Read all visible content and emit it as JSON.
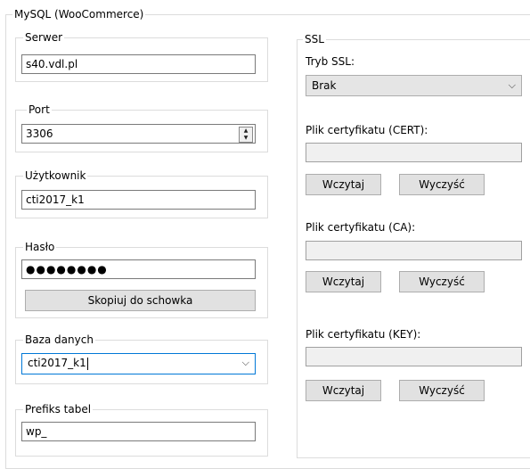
{
  "mysql_group": {
    "title": "MySQL (WooCommerce)"
  },
  "server": {
    "label": "Serwer",
    "value": "s40.vdl.pl"
  },
  "port": {
    "label": "Port",
    "value": "3306"
  },
  "user": {
    "label": "Użytkownik",
    "value": "cti2017_k1"
  },
  "password": {
    "label": "Hasło",
    "value": "●●●●●●●●",
    "copy_button": "Skopiuj do schowka"
  },
  "database": {
    "label": "Baza danych",
    "value": "cti2017_k1"
  },
  "prefix": {
    "label": "Prefiks tabel",
    "value": "wp_"
  },
  "ssl": {
    "title": "SSL",
    "mode_label": "Tryb SSL:",
    "mode_value": "Brak",
    "cert": {
      "label": "Plik certyfikatu (CERT):",
      "load": "Wczytaj",
      "clear": "Wyczyść"
    },
    "ca": {
      "label": "Plik certyfikatu (CA):",
      "load": "Wczytaj",
      "clear": "Wyczyść"
    },
    "key": {
      "label": "Plik certyfikatu (KEY):",
      "load": "Wczytaj",
      "clear": "Wyczyść"
    }
  }
}
